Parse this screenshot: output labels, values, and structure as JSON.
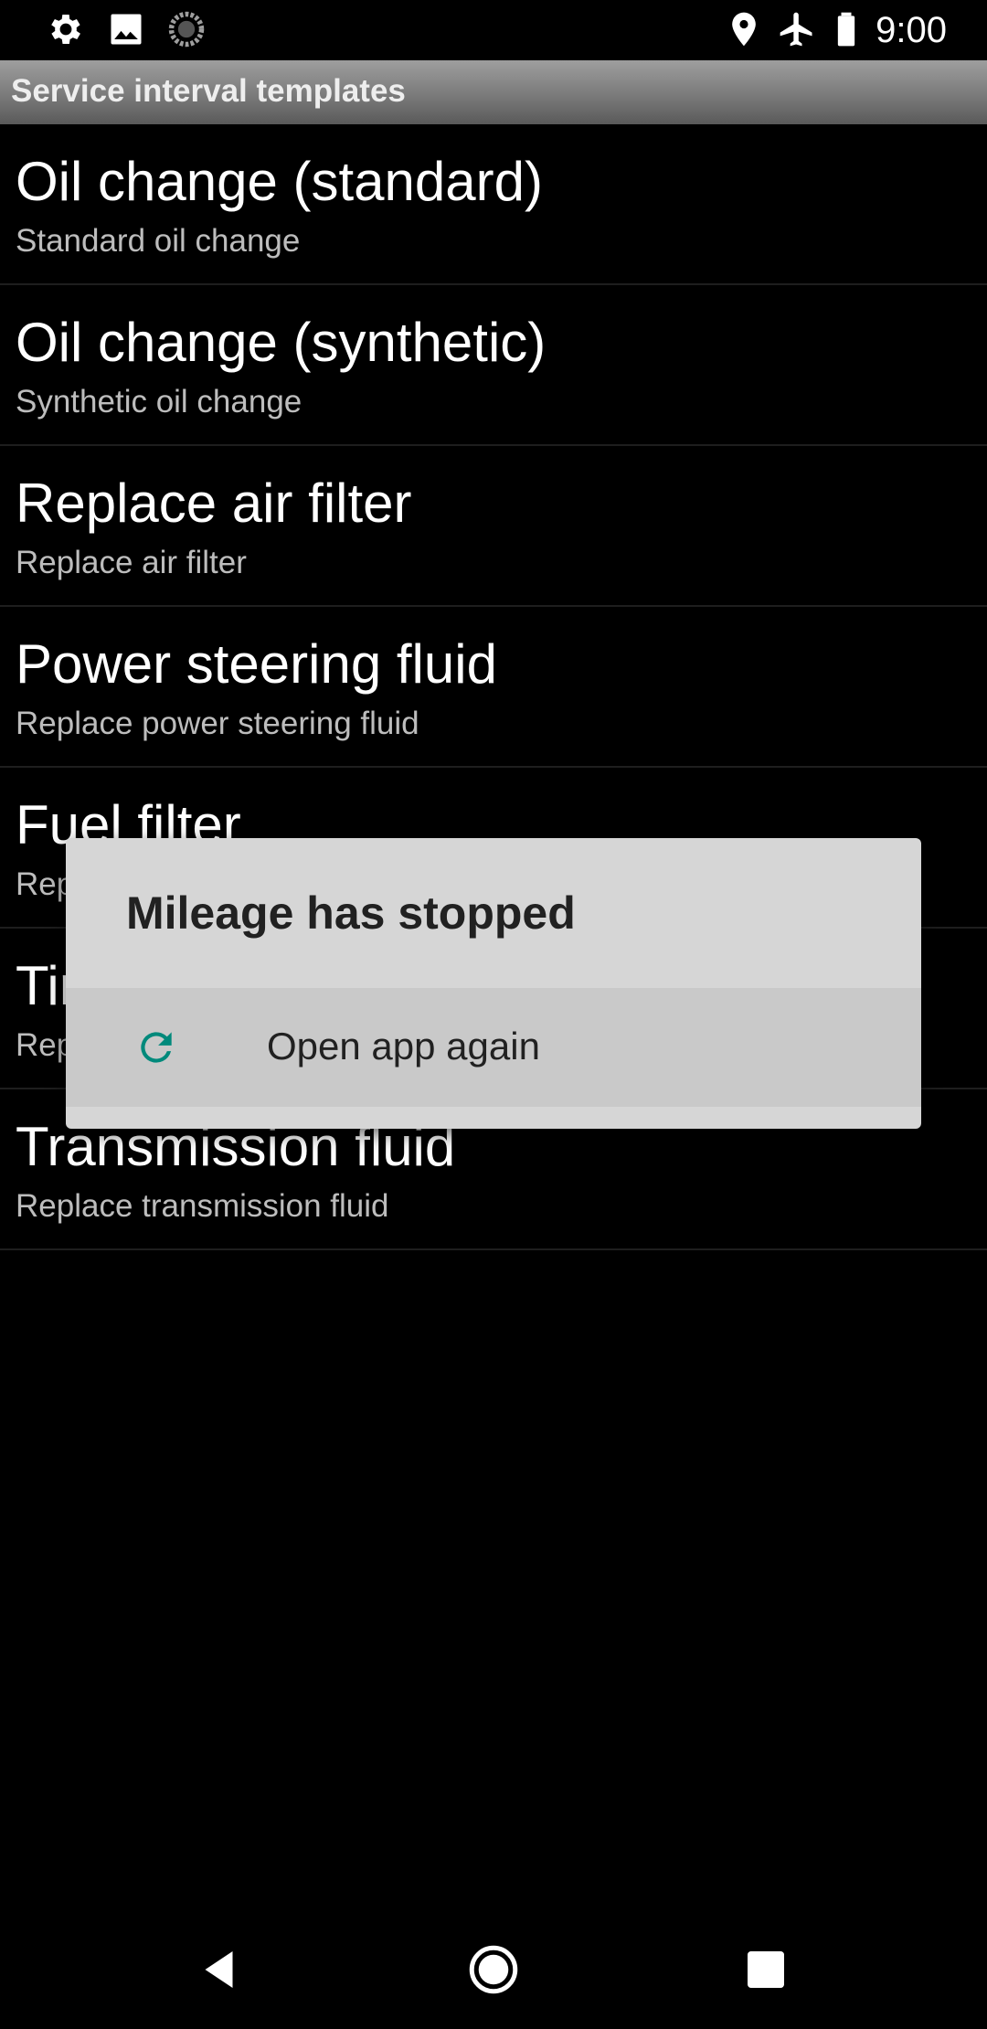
{
  "status_bar": {
    "time": "9:00",
    "left_icons": [
      "gear-icon",
      "image-icon",
      "sync-icon"
    ],
    "right_icons": [
      "location-icon",
      "airplane-icon",
      "battery-icon"
    ]
  },
  "app_bar": {
    "title": "Service interval templates"
  },
  "list": {
    "items": [
      {
        "title": "Oil change (standard)",
        "subtitle": "Standard oil change"
      },
      {
        "title": "Oil change (synthetic)",
        "subtitle": "Synthetic oil change"
      },
      {
        "title": "Replace air filter",
        "subtitle": "Replace air filter"
      },
      {
        "title": "Power steering fluid",
        "subtitle": "Replace power steering fluid"
      },
      {
        "title": "Fuel filter",
        "subtitle": "Replace fuel filter"
      },
      {
        "title": "Timing belt",
        "subtitle": "Replace timing belt"
      },
      {
        "title": "Transmission fluid",
        "subtitle": "Replace transmission fluid"
      }
    ]
  },
  "dialog": {
    "title": "Mileage has stopped",
    "action_label": "Open app again",
    "action_icon": "refresh-icon",
    "accent_color": "#00897b"
  },
  "nav_bar": {
    "buttons": [
      "back-icon",
      "home-icon",
      "recents-icon"
    ]
  }
}
